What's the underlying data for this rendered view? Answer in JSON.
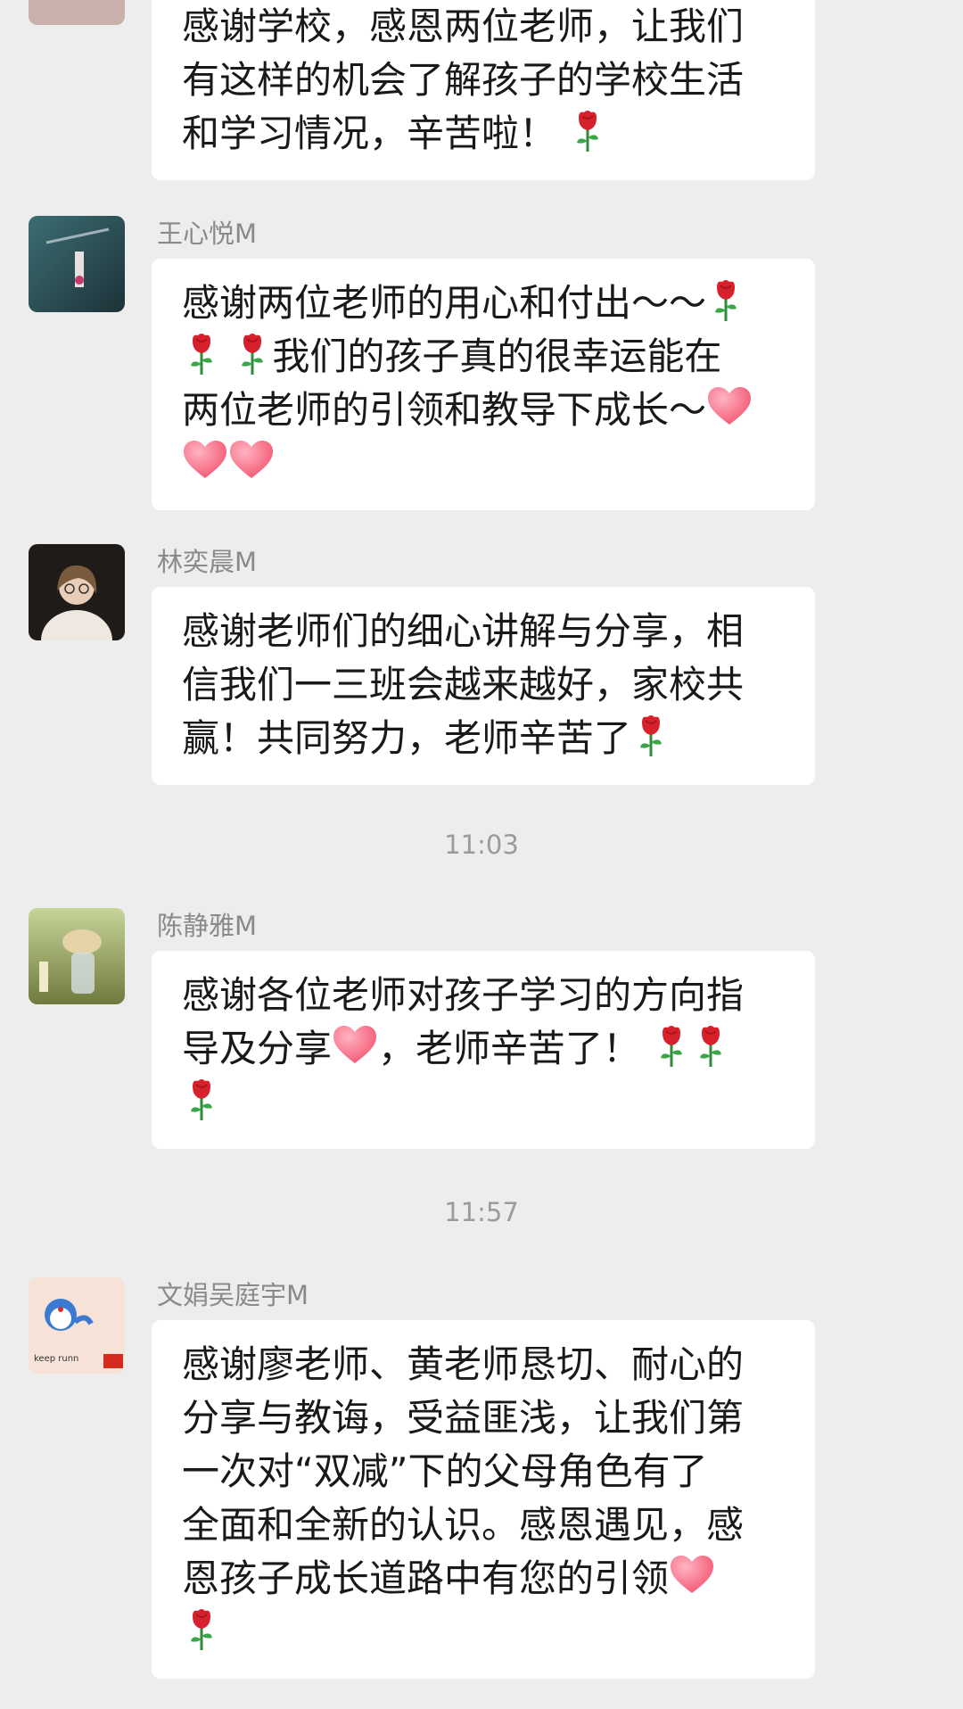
{
  "messages": [
    {
      "sender": "",
      "lines": [
        [
          "感谢学校，感恩两位老师，让我们"
        ],
        [
          "有这样的机会了解孩子的学校生活"
        ],
        [
          "和学习情况，辛苦啦！",
          "rose"
        ]
      ]
    },
    {
      "sender": "王心悦M",
      "lines": [
        [
          "感谢两位老师的用心和付出～～",
          "rose"
        ],
        [
          "rose",
          "rose",
          "我们的孩子真的很幸运能在"
        ],
        [
          "两位老师的引领和教导下成长～",
          "heart"
        ],
        [
          "heart",
          "heart"
        ]
      ]
    },
    {
      "sender": "林奕晨M",
      "lines": [
        [
          "感谢老师们的细心讲解与分享，相"
        ],
        [
          "信我们一三班会越来越好，家校共"
        ],
        [
          "赢！共同努力，老师辛苦了",
          "rose"
        ]
      ]
    },
    {
      "time": "11:03"
    },
    {
      "sender": "陈静雅M",
      "lines": [
        [
          "感谢各位老师对孩子学习的方向指"
        ],
        [
          "导及分享",
          "heart",
          "，老师辛苦了！ ",
          "rose",
          "rose"
        ],
        [
          "rose"
        ]
      ]
    },
    {
      "time": "11:57"
    },
    {
      "sender": "文娟吴庭宇M",
      "avatar_caption": "keep runn",
      "lines": [
        [
          "感谢廖老师、黄老师恳切、耐心的"
        ],
        [
          "分享与教诲，受益匪浅，让我们第"
        ],
        [
          "一次对“双减”下的父母角色有了"
        ],
        [
          "全面和全新的认识。感恩遇见，感"
        ],
        [
          "恩孩子成长道路中有您的引领",
          "heart"
        ],
        [
          "rose"
        ]
      ]
    }
  ]
}
